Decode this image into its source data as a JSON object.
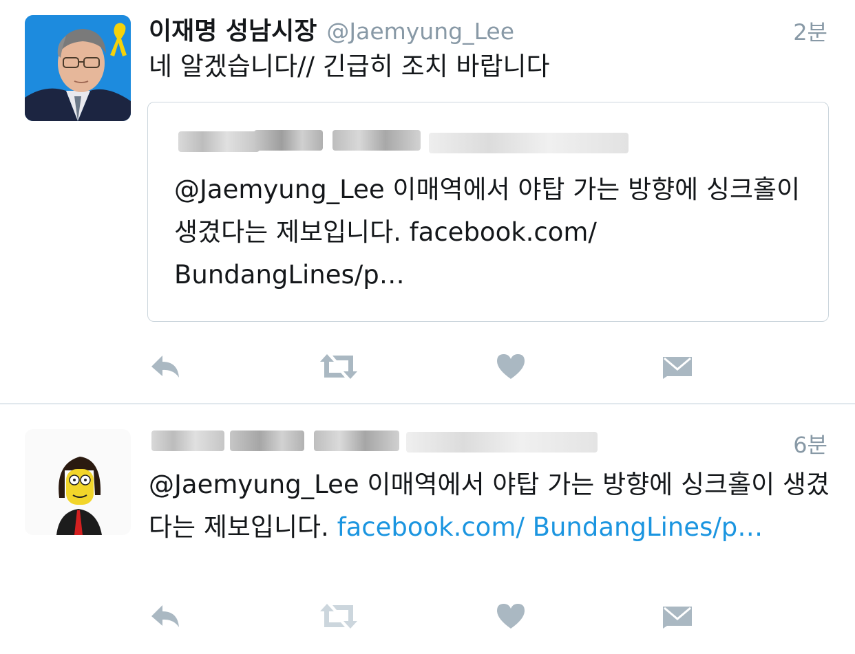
{
  "tweets": [
    {
      "display_name": "이재명 성남시장",
      "handle": "@Jaemyung_Lee",
      "time": "2분",
      "text": "네 알겠습니다// 긴급히 조치 바랍니다",
      "quote": {
        "text": "@Jaemyung_Lee 이매역에서 야탑 가는 방향에 싱크홀이 생겼다는 제보입니다. facebook.com/ BundangLines/p…"
      }
    },
    {
      "time": "6분",
      "text_main": "@Jaemyung_Lee 이매역에서 야탑 가는 방향에 싱크홀이 생겼다는 제보입니다. ",
      "link": "facebook.com/ BundangLines/p…"
    }
  ],
  "colors": {
    "accent": "#1b95e0",
    "action_icon": "#aab8c2",
    "muted_text": "#8899a6"
  },
  "icons": [
    "reply-icon",
    "retweet-icon",
    "like-icon",
    "direct-message-icon"
  ]
}
